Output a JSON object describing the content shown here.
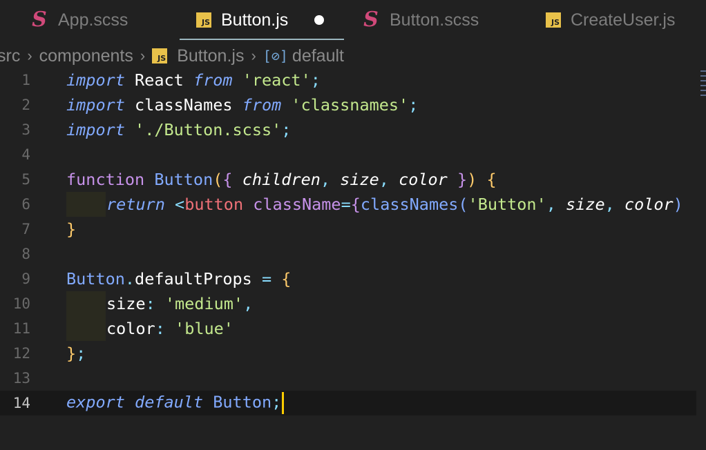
{
  "tabs": [
    {
      "label": "App.scss",
      "icon": "sass-icon",
      "active": false
    },
    {
      "label": "Button.js",
      "icon": "js-icon",
      "active": true,
      "dirty": true
    },
    {
      "label": "Button.scss",
      "icon": "sass-icon",
      "active": false
    },
    {
      "label": "CreateUser.js",
      "icon": "js-icon",
      "active": false
    }
  ],
  "icons": {
    "sass_glyph": "S",
    "js_glyph": "JS",
    "symbol_glyph": "[⊘]",
    "chevron": "›"
  },
  "breadcrumb": {
    "items": [
      "src",
      "components",
      "Button.js",
      "default"
    ]
  },
  "editor": {
    "line_numbers": [
      "1",
      "2",
      "3",
      "4",
      "5",
      "6",
      "7",
      "8",
      "9",
      "10",
      "11",
      "12",
      "13",
      "14"
    ],
    "current_line": 14,
    "tokens": {
      "l1": [
        "import",
        " React ",
        "from",
        " ",
        "'react'",
        ";"
      ],
      "l2": [
        "import",
        " classNames ",
        "from",
        " ",
        "'classnames'",
        ";"
      ],
      "l3": [
        "import",
        " ",
        "'./Button.scss'",
        ";"
      ],
      "l5": [
        "function",
        " ",
        "Button",
        "(",
        "{",
        " ",
        "children",
        ", ",
        "size",
        ", ",
        "color",
        " ",
        "}",
        ")",
        " ",
        "{"
      ],
      "l6": [
        "return",
        " ",
        "<",
        "button",
        " ",
        "className",
        "=",
        "{",
        "classNames",
        "(",
        "'Button'",
        ", ",
        "size",
        ", ",
        "color",
        ")"
      ],
      "l7": [
        "}"
      ],
      "l9": [
        "Button",
        ".",
        "defaultProps",
        " ",
        "=",
        " ",
        "{"
      ],
      "l10": [
        "size",
        ": ",
        "'medium'",
        ","
      ],
      "l11": [
        "color",
        ": ",
        "'blue'"
      ],
      "l12": [
        "}",
        ";"
      ],
      "l14": [
        "export",
        " ",
        "default",
        " ",
        "Button",
        ";"
      ]
    }
  },
  "colors": {
    "background": "#212121",
    "keyword": "#c792ea",
    "string": "#c3e88d",
    "function": "#82aaff",
    "cursor": "#ffcc00"
  }
}
